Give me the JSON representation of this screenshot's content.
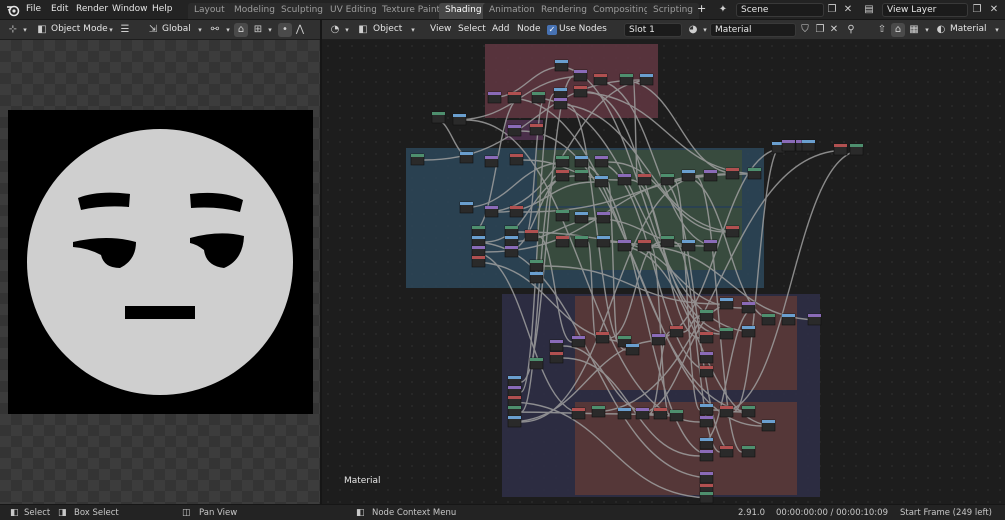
{
  "topbar": {
    "menus": [
      "File",
      "Edit",
      "Render",
      "Window",
      "Help"
    ],
    "workspaces": [
      "Layout",
      "Modeling",
      "Sculpting",
      "UV Editing",
      "Texture Paint",
      "Shading",
      "Animation",
      "Rendering",
      "Compositing",
      "Scripting"
    ],
    "active_workspace": "Shading",
    "add_tab_label": "+",
    "scene_name": "Scene",
    "view_layer_name": "View Layer"
  },
  "image_editor_header": {
    "mode": "Object Mode",
    "orientation": "Global"
  },
  "node_editor_header": {
    "object_type": "Object",
    "menus": [
      "View",
      "Select",
      "Add",
      "Node"
    ],
    "use_nodes_label": "Use Nodes",
    "use_nodes_checked": true,
    "slot": "Slot 1",
    "material_name": "Material",
    "shader_type": "Material"
  },
  "node_editor": {
    "tree_name": "Material"
  },
  "statusbar": {
    "select": "Select",
    "box_select": "Box Select",
    "pan_view": "Pan View",
    "node_context_menu": "Node Context Menu",
    "version": "2.91.0",
    "timecode": "00:00:00:00 / 00:00:10:09",
    "start_frame": "Start Frame (249 left)"
  },
  "colors": {
    "frame_pink": "#5e3640",
    "frame_blue": "#2c4658",
    "frame_green": "#3a4d3c",
    "frame_navy": "#2d2d43",
    "frame_brown": "#5a3837",
    "accent": "#4772b3"
  }
}
